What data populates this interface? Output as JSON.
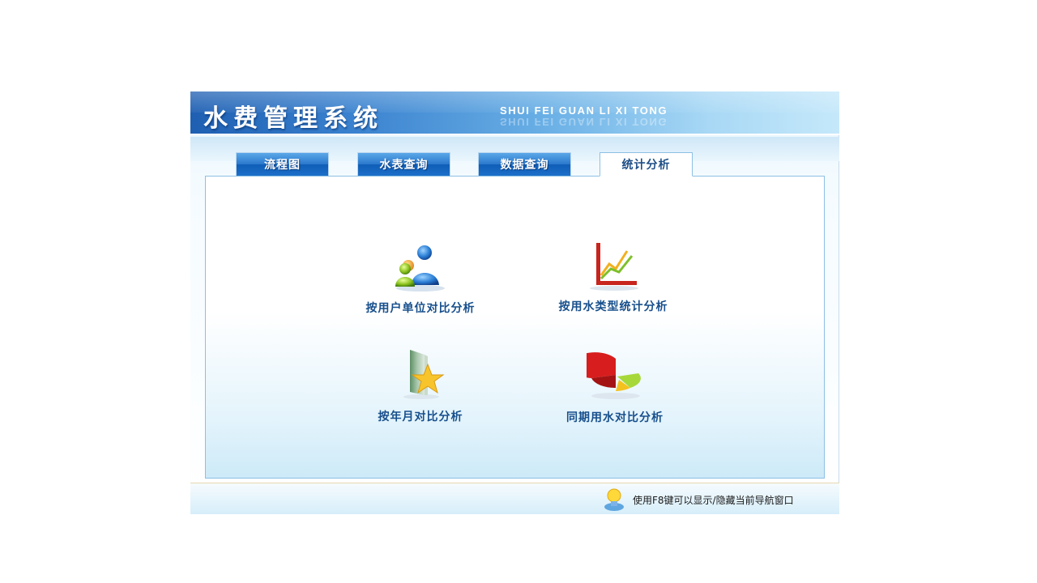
{
  "app": {
    "title": "水费管理系统",
    "subtitle": "SHUI FEI GUAN LI XI TONG"
  },
  "tabs": [
    {
      "label": "流程图",
      "active": false
    },
    {
      "label": "水表查询",
      "active": false
    },
    {
      "label": "数据查询",
      "active": false
    },
    {
      "label": "统计分析",
      "active": true
    }
  ],
  "analysis_items": [
    {
      "label": "按用户单位对比分析",
      "icon": "users-icon"
    },
    {
      "label": "按用水类型统计分析",
      "icon": "line-chart-icon"
    },
    {
      "label": "按年月对比分析",
      "icon": "star-book-icon"
    },
    {
      "label": "同期用水对比分析",
      "icon": "pie-chart-icon"
    }
  ],
  "status": {
    "hint": "使用F8键可以显示/隐藏当前导航窗口",
    "icon": "lightbulb-icon"
  },
  "colors": {
    "banner": "#1e5fb2",
    "tab_active_text": "#1d4e86",
    "item_label": "#174f8c",
    "panel_border": "#8cc0e4"
  }
}
